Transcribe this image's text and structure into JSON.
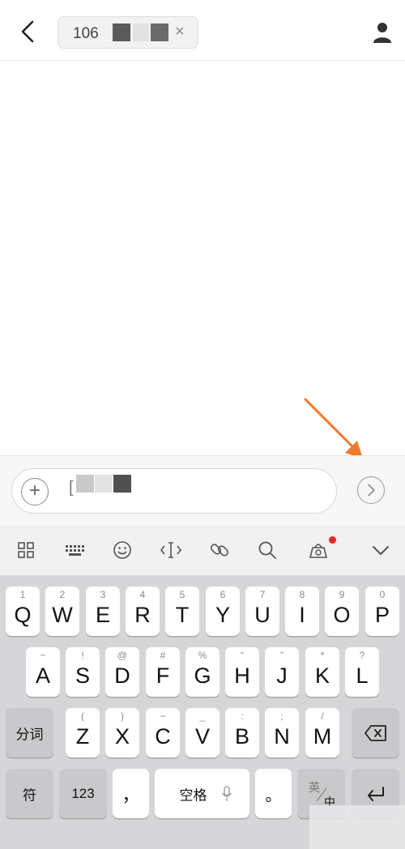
{
  "header": {
    "recipient_number": "106",
    "chip_close": "×"
  },
  "composer": {
    "text": "["
  },
  "keyboard": {
    "row1": [
      {
        "sub": "1",
        "main": "Q"
      },
      {
        "sub": "2",
        "main": "W"
      },
      {
        "sub": "3",
        "main": "E"
      },
      {
        "sub": "4",
        "main": "R"
      },
      {
        "sub": "5",
        "main": "T"
      },
      {
        "sub": "6",
        "main": "Y"
      },
      {
        "sub": "7",
        "main": "U"
      },
      {
        "sub": "8",
        "main": "I"
      },
      {
        "sub": "9",
        "main": "O"
      },
      {
        "sub": "0",
        "main": "P"
      }
    ],
    "row2": [
      {
        "sub": "~",
        "main": "A"
      },
      {
        "sub": "!",
        "main": "S"
      },
      {
        "sub": "@",
        "main": "D"
      },
      {
        "sub": "#",
        "main": "F"
      },
      {
        "sub": "%",
        "main": "G"
      },
      {
        "sub": "“",
        "main": "H"
      },
      {
        "sub": "”",
        "main": "J"
      },
      {
        "sub": "*",
        "main": "K"
      },
      {
        "sub": "?",
        "main": "L"
      }
    ],
    "row3": [
      {
        "sub": "(",
        "main": "Z"
      },
      {
        "sub": ")",
        "main": "X"
      },
      {
        "sub": "−",
        "main": "C"
      },
      {
        "sub": "_",
        "main": "V"
      },
      {
        "sub": ":",
        "main": "B"
      },
      {
        "sub": ";",
        "main": "N"
      },
      {
        "sub": "/",
        "main": "M"
      }
    ],
    "segment_label": "分词",
    "symbol_label": "符",
    "numbers_label": "123",
    "comma_label": "，",
    "space_label": "空格",
    "period_label": "。",
    "lang_top": "英",
    "lang_bottom": "中"
  },
  "colors": {
    "annotation_arrow": "#f07a2c",
    "notification_dot": "#e8262a"
  }
}
